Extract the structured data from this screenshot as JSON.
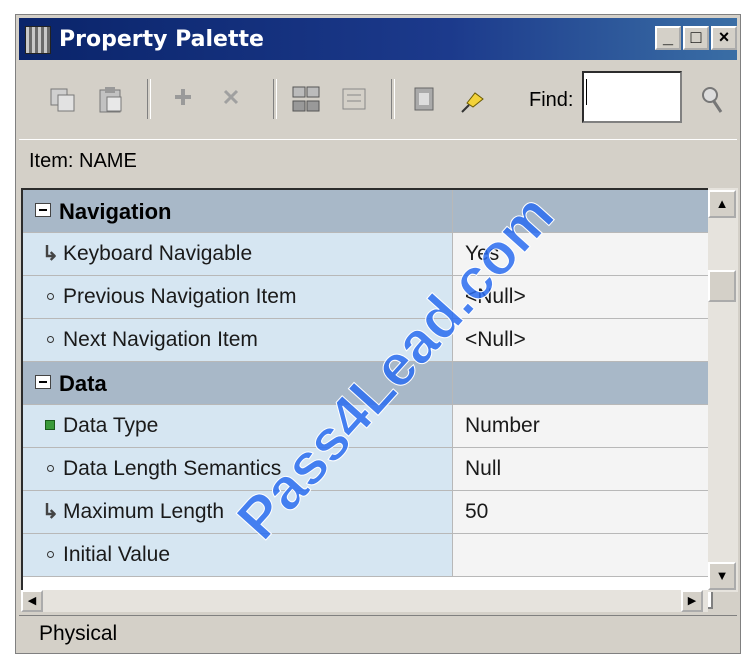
{
  "window": {
    "title": "Property Palette"
  },
  "titlebar_buttons": {
    "minimize": "_",
    "maximize": "□",
    "close": "×"
  },
  "toolbar": {
    "find_label": "Find:",
    "find_value": "",
    "icons": [
      "copy-properties-icon",
      "paste-properties-icon",
      "add-property-icon",
      "delete-property-icon",
      "union-icon",
      "intersection-icon",
      "inherit-icon",
      "freeze-pin-icon",
      "search-icon"
    ]
  },
  "item_label": "Item: NAME",
  "properties": [
    {
      "type": "category",
      "label": "Navigation",
      "value": ""
    },
    {
      "type": "property",
      "marker": "arrow",
      "label": "Keyboard Navigable",
      "value": "Yes"
    },
    {
      "type": "property",
      "marker": "dot",
      "label": "Previous Navigation Item",
      "value": "<Null>"
    },
    {
      "type": "property",
      "marker": "dot",
      "label": "Next Navigation Item",
      "value": "<Null>"
    },
    {
      "type": "category",
      "label": "Data",
      "value": ""
    },
    {
      "type": "property",
      "marker": "square",
      "label": "Data Type",
      "value": "Number"
    },
    {
      "type": "property",
      "marker": "dot",
      "label": "Data Length Semantics",
      "value": "Null"
    },
    {
      "type": "property",
      "marker": "arrow",
      "label": "Maximum Length",
      "value": "50"
    },
    {
      "type": "property",
      "marker": "dot",
      "label": "Initial Value",
      "value": ""
    }
  ],
  "status": "Physical",
  "watermark": "Pass4Lead.com",
  "colors": {
    "titlebar": "#0a246a",
    "category_row": "#a8b8c8",
    "name_cell": "#d6e6f2",
    "window_face": "#d4d0c8"
  }
}
